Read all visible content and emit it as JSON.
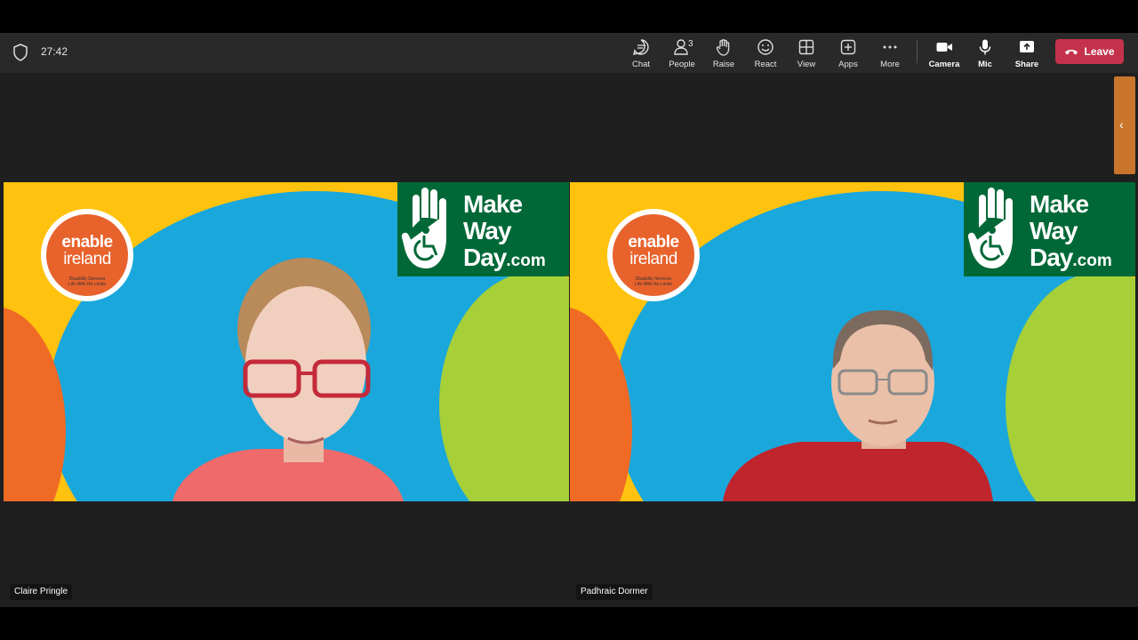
{
  "meeting": {
    "timer": "27:42"
  },
  "toolbar": {
    "chat": "Chat",
    "people": "People",
    "people_count": "3",
    "raise": "Raise",
    "react": "React",
    "view": "View",
    "apps": "Apps",
    "more": "More",
    "camera": "Camera",
    "mic": "Mic",
    "share": "Share",
    "leave": "Leave"
  },
  "tiles": [
    {
      "name": "Claire Pringle"
    },
    {
      "name": "Padhraic Dormer"
    }
  ],
  "background": {
    "enable_word1": "enable",
    "enable_word2": "ireland",
    "enable_sub1": "Disability Services",
    "enable_sub2": "Life With No Limits",
    "mwd_line1": "Make",
    "mwd_line2": "Way",
    "mwd_line3": "Day",
    "mwd_com": ".com"
  },
  "colors": {
    "leave_red": "#c4314b",
    "mwd_green": "#006837",
    "bg_blue": "#1aa7dc",
    "bg_yellow": "#ffc20e"
  }
}
